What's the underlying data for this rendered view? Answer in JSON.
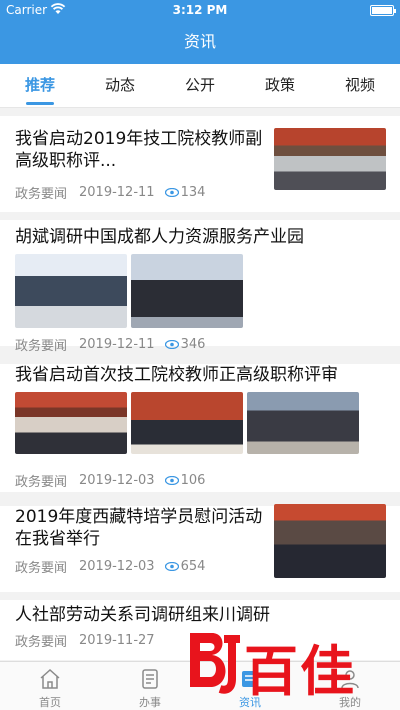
{
  "status_bar": {
    "carrier": "Carrier",
    "time": "3:12 PM"
  },
  "nav": {
    "title": "资讯"
  },
  "tabs": [
    {
      "label": "推荐",
      "active": true
    },
    {
      "label": "动态",
      "active": false
    },
    {
      "label": "公开",
      "active": false
    },
    {
      "label": "政策",
      "active": false
    },
    {
      "label": "视频",
      "active": false
    }
  ],
  "articles": [
    {
      "title": "我省启动2019年技工院校教师副高级职称评...",
      "source": "政务要闻",
      "date": "2019-12-11",
      "views": "134"
    },
    {
      "title": "胡斌调研中国成都人力资源服务产业园",
      "source": "政务要闻",
      "date": "2019-12-11",
      "views": "346"
    },
    {
      "title": "我省启动首次技工院校教师正高级职称评审",
      "source": "政务要闻",
      "date": "2019-12-03",
      "views": "106"
    },
    {
      "title": "2019年度西藏特培学员慰问活动在我省举行",
      "source": "政务要闻",
      "date": "2019-12-03",
      "views": "654"
    },
    {
      "title": "人社部劳动关系司调研组来川调研",
      "source": "政务要闻",
      "date": "2019-11-27",
      "views": ""
    }
  ],
  "tabbar": [
    {
      "label": "首页",
      "icon": "home-icon"
    },
    {
      "label": "办事",
      "icon": "document-icon"
    },
    {
      "label": "资讯",
      "icon": "news-icon"
    },
    {
      "label": "我的",
      "icon": "user-icon"
    }
  ],
  "watermark": {
    "text": "百佳"
  },
  "colors": {
    "accent": "#3b97e3",
    "watermark_red": "#e8141c"
  }
}
